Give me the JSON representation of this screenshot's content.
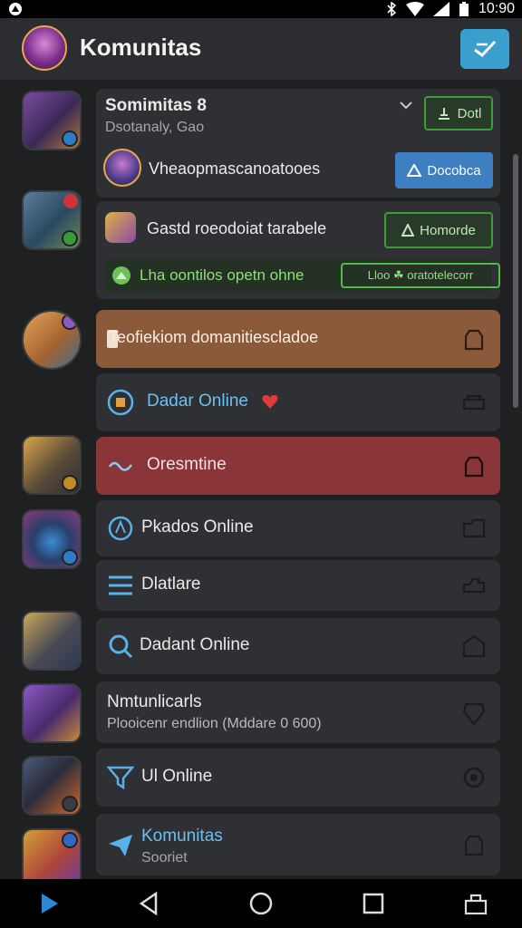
{
  "status_bar": {
    "time": "10:90"
  },
  "app_bar": {
    "title": "Komunitas"
  },
  "header_card": {
    "title": "Somimitas 8",
    "subtitle": "Dsotanaly, Gao",
    "button_1": "Dotl",
    "row_text": "Vheaopmascanoatooes",
    "button_2": "Docobca"
  },
  "invite_card": {
    "text": "Gastd roeodoiat tarabele",
    "button": "Homorde",
    "online_text": "Lha oontilos opetn ohne",
    "online_chip": "Lloo ☘ oratotelecorr"
  },
  "list_items": [
    {
      "label": "Teofiekiom domanitiescladoe",
      "sub": ""
    },
    {
      "label": "Dadar Online",
      "sub": ""
    },
    {
      "label": "Oresmtine",
      "sub": ""
    },
    {
      "label": "Pkados Online",
      "sub": ""
    },
    {
      "label": "Dlatlare",
      "sub": ""
    },
    {
      "label": "Dadant Online",
      "sub": ""
    },
    {
      "label": "Nmtunlicarls",
      "sub": "Plooicenr endlion (Mddare 0 600)"
    },
    {
      "label": "Ul Online",
      "sub": ""
    },
    {
      "label": "Komunitas",
      "sub": "Sooriet"
    }
  ],
  "colors": {
    "accent": "#3a9fcc",
    "green": "#3f9a3a",
    "orange_row": "#8a5a3a",
    "red_row": "#8a3638",
    "background": "#1f2022"
  },
  "icons": [
    "wifi-icon",
    "signal-icon",
    "battery-icon",
    "compose-icon",
    "chevron-down-icon",
    "back-nav-icon",
    "home-nav-icon",
    "recents-nav-icon"
  ]
}
